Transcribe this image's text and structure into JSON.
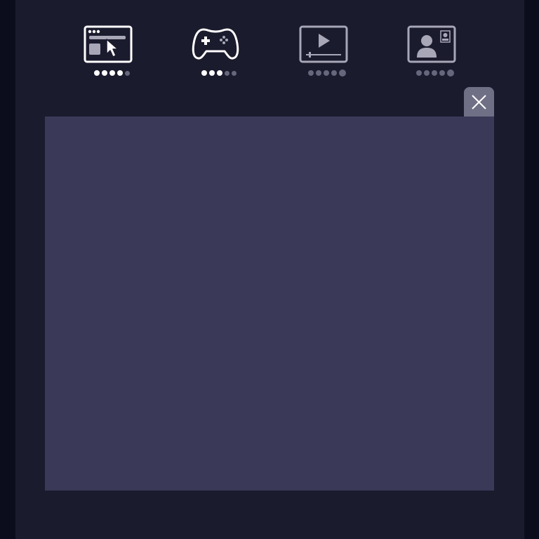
{
  "colors": {
    "app_background": "#1b1b2e",
    "outer_background": "#0c0d1c",
    "panel_background": "#3a3957",
    "close_button_background": "#6f6f86",
    "active_icon": "#ffffff",
    "inactive_icon": "#a7a7b8",
    "inactive_dot": "#66667c"
  },
  "categories": [
    {
      "icon": "browser-cursor-icon",
      "active": true,
      "rating": 4,
      "rating_max": 5
    },
    {
      "icon": "gamepad-icon",
      "active": true,
      "rating": 3,
      "rating_max": 5
    },
    {
      "icon": "video-player-icon",
      "active": false,
      "rating": 0,
      "rating_max": 5
    },
    {
      "icon": "video-call-icon",
      "active": false,
      "rating": 0,
      "rating_max": 5
    }
  ],
  "close_button": {
    "icon": "close-icon"
  }
}
